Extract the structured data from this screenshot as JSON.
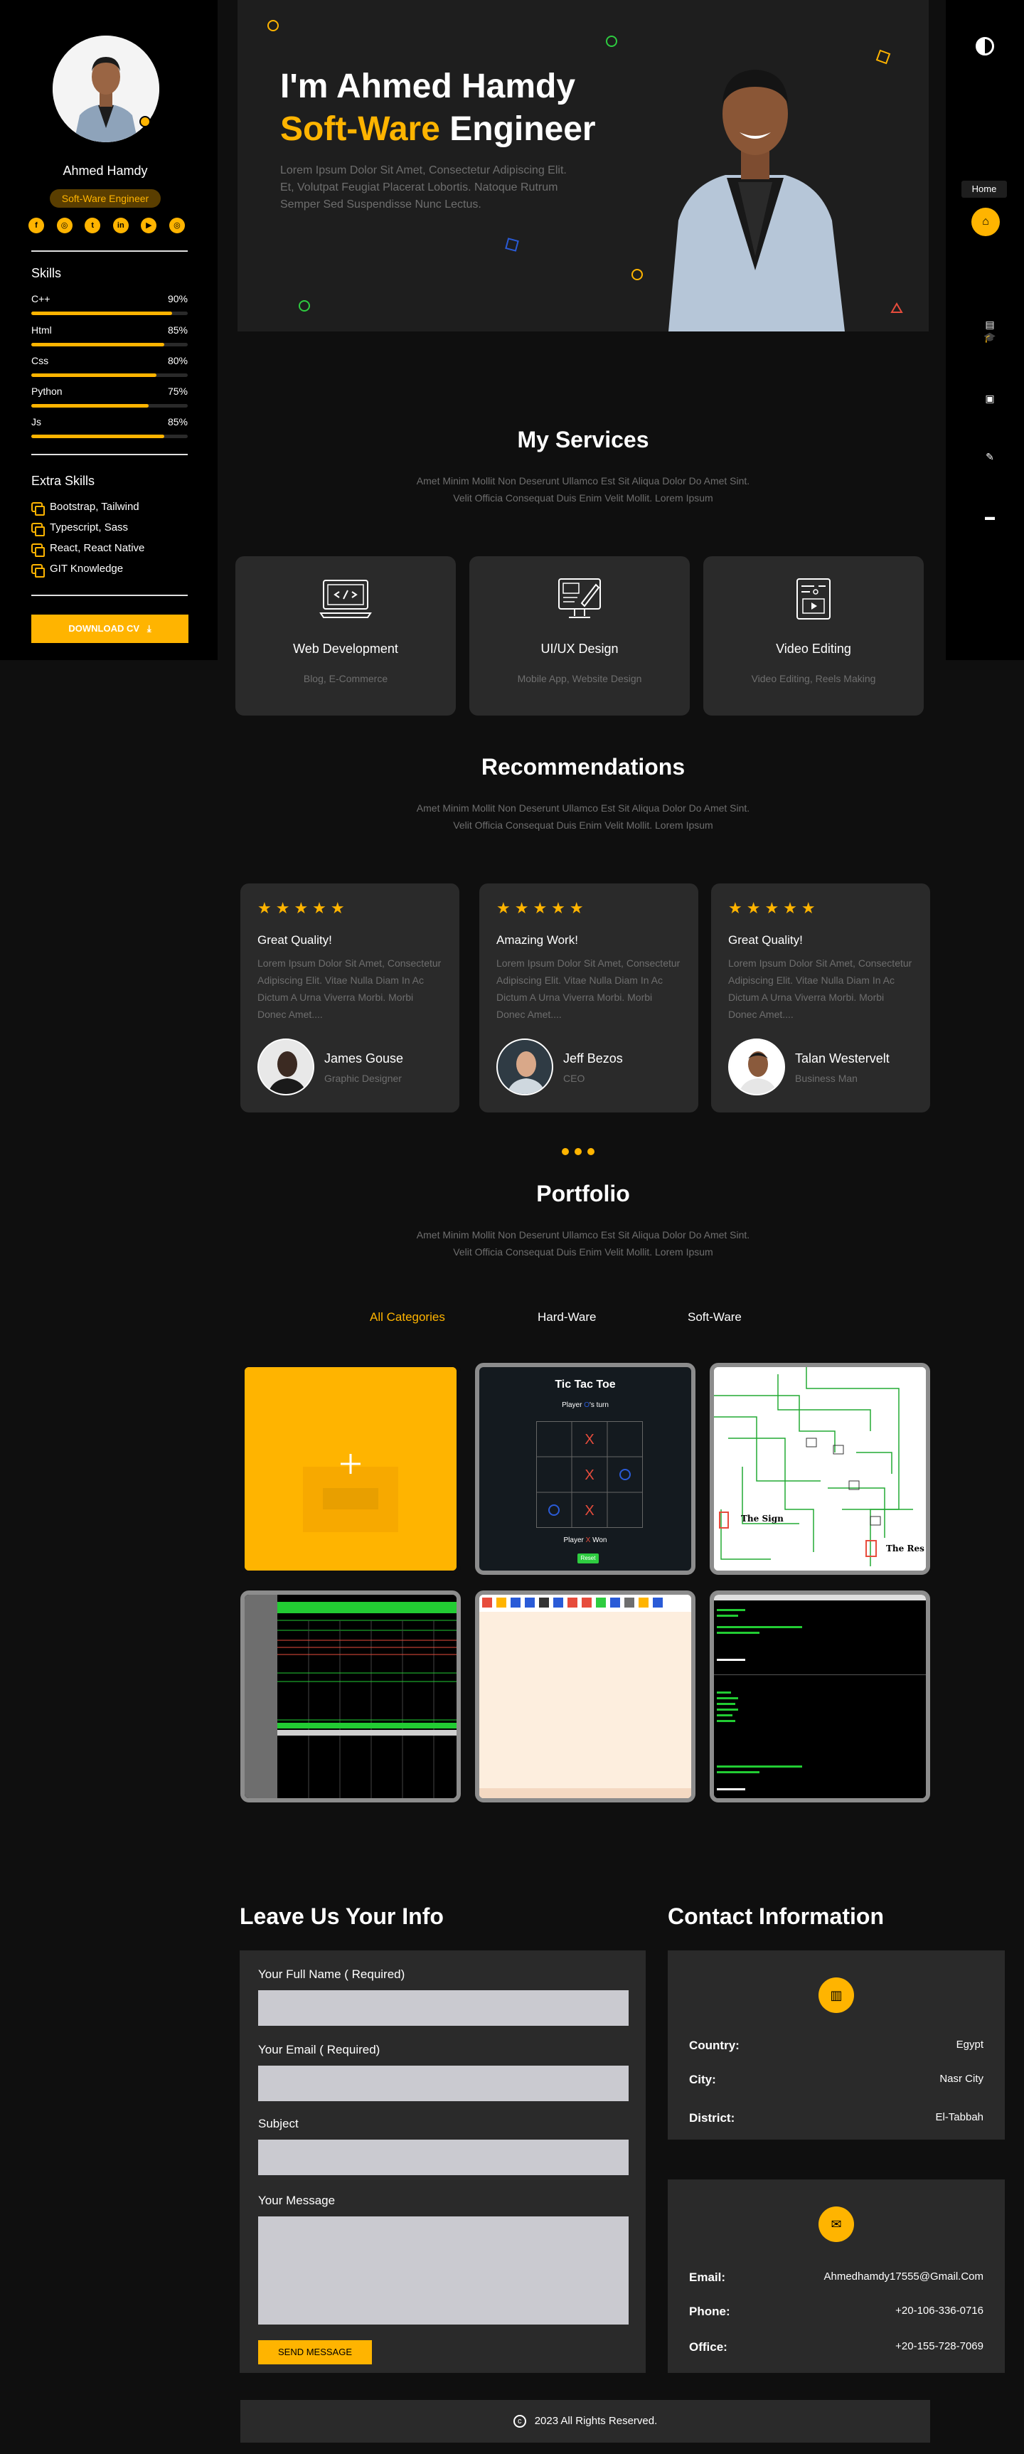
{
  "profile": {
    "name": "Ahmed Hamdy",
    "role": "Soft-Ware Engineer",
    "socials": [
      "f",
      "◎",
      "t",
      "in",
      "▶",
      "◎"
    ],
    "skills_title": "Skills",
    "skills": [
      {
        "name": "C++",
        "value": "90%",
        "level": 0.9
      },
      {
        "name": "Html",
        "value": "85%",
        "level": 0.85
      },
      {
        "name": "Css",
        "value": "80%",
        "level": 0.8
      },
      {
        "name": "Python",
        "value": "75%",
        "level": 0.75
      },
      {
        "name": "Js",
        "value": "85%",
        "level": 0.85
      }
    ],
    "extra_title": "Extra Skills",
    "extra": [
      "Bootstrap, Tailwind",
      "Typescript, Sass",
      "React, React Native",
      "GIT Knowledge"
    ],
    "download_cv": "DOWNLOAD CV"
  },
  "nav": {
    "tooltip": "Home",
    "icons": [
      "theme-toggle-icon",
      "home-icon",
      "resume-icon",
      "graduation-icon",
      "briefcase-icon",
      "feather-icon",
      "chat-icon"
    ]
  },
  "hero": {
    "greeting": "I'm Ahmed Hamdy",
    "title_accent": "Soft-Ware",
    "title_rest": " Engineer",
    "description": "Lorem Ipsum Dolor Sit Amet, Consectetur Adipiscing Elit. Et, Volutpat Feugiat Placerat Lobortis. Natoque Rutrum Semper Sed Suspendisse Nunc Lectus."
  },
  "services": {
    "title": "My Services",
    "subtitle": "Amet Minim Mollit Non Deserunt Ullamco Est Sit Aliqua Dolor Do Amet Sint. Velit Officia Consequat Duis Enim Velit Mollit. Lorem Ipsum",
    "cards": [
      {
        "title": "Web Development",
        "sub": "Blog, E-Commerce"
      },
      {
        "title": "UI/UX Design",
        "sub": "Mobile App, Website Design"
      },
      {
        "title": "Video Editing",
        "sub": "Video Editing, Reels Making"
      }
    ]
  },
  "recommendations": {
    "title": "Recommendations",
    "subtitle": "Amet Minim Mollit Non Deserunt Ullamco Est Sit Aliqua Dolor Do Amet Sint. Velit Officia Consequat Duis Enim Velit Mollit. Lorem Ipsum",
    "stars": "★★★★★",
    "cards": [
      {
        "title": "Great Quality!",
        "body": "Lorem Ipsum Dolor Sit Amet, Consectetur Adipiscing Elit. Vitae Nulla Diam In Ac Dictum A Urna Viverra Morbi. Morbi Donec Amet....",
        "name": "James Gouse",
        "role": "Graphic Designer"
      },
      {
        "title": "Amazing Work!",
        "body": "Lorem Ipsum Dolor Sit Amet, Consectetur Adipiscing Elit. Vitae Nulla Diam In Ac Dictum A Urna Viverra Morbi. Morbi Donec Amet....",
        "name": "Jeff Bezos",
        "role": "CEO"
      },
      {
        "title": "Great Quality!",
        "body": "Lorem Ipsum Dolor Sit Amet, Consectetur Adipiscing Elit. Vitae Nulla Diam In Ac Dictum A Urna Viverra Morbi. Morbi Donec Amet....",
        "name": "Talan Westervelt",
        "role": "Business Man"
      }
    ]
  },
  "portfolio": {
    "title": "Portfolio",
    "subtitle": "Amet Minim Mollit Non Deserunt Ullamco Est Sit Aliqua Dolor Do Amet Sint. Velit Officia Consequat Duis Enim Velit Mollit. Lorem Ipsum",
    "filters": [
      "All Categories",
      "Hard-Ware",
      "Soft-Ware"
    ],
    "ttt": {
      "title": "Tic Tac Toe",
      "turn_pre": "Player ",
      "turn_mark": "O",
      "turn_post": "'s turn",
      "won_pre": "Player ",
      "won_mark": "X",
      "won_post": " Won",
      "reset": "Reset"
    },
    "circuit": {
      "label_left": "The Sign",
      "label_right": "The Res"
    }
  },
  "contact_form": {
    "title": "Leave Us Your Info",
    "name_label": "Your Full Name ( Required)",
    "email_label": "Your Email ( Required)",
    "subject_label": "Subject",
    "message_label": "Your Message",
    "send": "SEND MESSAGE"
  },
  "contact_info": {
    "title": "Contact Information",
    "location": [
      {
        "k": "Country:",
        "v": "Egypt"
      },
      {
        "k": "City:",
        "v": "Nasr City"
      },
      {
        "k": "District:",
        "v": "El-Tabbah"
      }
    ],
    "reach": [
      {
        "k": "Email:",
        "v": "Ahmedhamdy17555@Gmail.Com"
      },
      {
        "k": "Phone:",
        "v": "+20-106-336-0716"
      },
      {
        "k": "Office:",
        "v": "+20-155-728-7069"
      }
    ]
  },
  "footer": {
    "text": "2023 All Rights Reserved."
  },
  "colors": {
    "accent": "#ffb400",
    "panel": "#2a2a2a",
    "bg": "#0f0f0f"
  }
}
